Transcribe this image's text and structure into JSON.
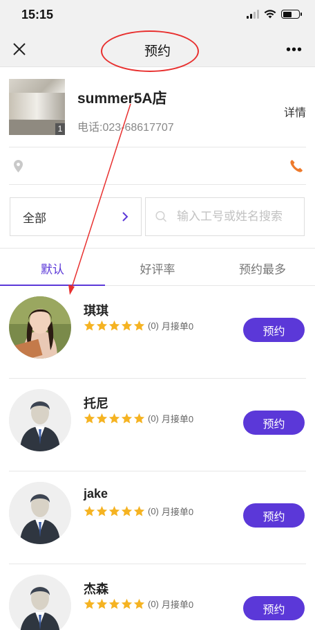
{
  "status": {
    "time": "15:15"
  },
  "nav": {
    "title": "预约",
    "close_icon": "close-icon",
    "more_icon": "more-icon"
  },
  "store": {
    "name": "summer5A店",
    "phone": "电话:023-68617707",
    "detail": "详情",
    "photo_count": "1"
  },
  "filter": {
    "label": "全部"
  },
  "search": {
    "placeholder": "输入工号或姓名搜索"
  },
  "tabs": [
    {
      "label": "默认"
    },
    {
      "label": "好评率"
    },
    {
      "label": "预约最多"
    }
  ],
  "staff": [
    {
      "name": "琪琪",
      "rating_count": "(0)",
      "monthly": "月接单0",
      "button": "预约",
      "stars": 5,
      "avatar": "photo"
    },
    {
      "name": "托尼",
      "rating_count": "(0)",
      "monthly": "月接单0",
      "button": "预约",
      "stars": 5,
      "avatar": "placeholder"
    },
    {
      "name": "jake",
      "rating_count": "(0)",
      "monthly": "月接单0",
      "button": "预约",
      "stars": 5,
      "avatar": "placeholder"
    },
    {
      "name": "杰森",
      "rating_count": "(0)",
      "monthly": "月接单0",
      "button": "预约",
      "stars": 5,
      "avatar": "placeholder"
    }
  ],
  "colors": {
    "accent": "#5b38d8",
    "star": "#f5b322",
    "phone_icon": "#ee7a2b",
    "annotation": "#e8302f"
  }
}
